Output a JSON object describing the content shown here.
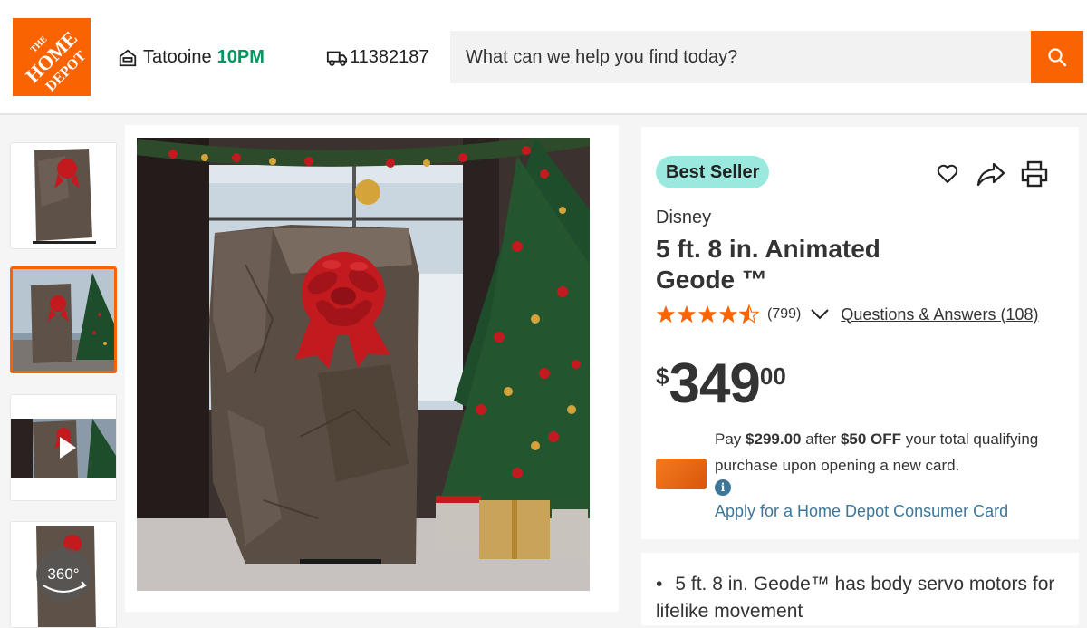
{
  "header": {
    "logo_text": "THE HOME DEPOT",
    "store_icon": "store-icon",
    "store_name": "Tatooine",
    "store_time": "10PM",
    "delivery_icon": "truck-icon",
    "delivery_zip": "11382187",
    "search_placeholder": "What can we help you find today?",
    "search_icon": "search-icon"
  },
  "gallery": {
    "thumbnails": [
      {
        "kind": "image",
        "active": false
      },
      {
        "kind": "image",
        "active": true
      },
      {
        "kind": "video",
        "active": false
      },
      {
        "kind": "360",
        "active": false,
        "label": "360°"
      }
    ]
  },
  "product": {
    "badge": "Best Seller",
    "actions": [
      "favorite-icon",
      "share-icon",
      "print-icon"
    ],
    "brand": "Disney",
    "title": "5 ft. 8 in. Animated Geode ™",
    "rating": 4.5,
    "review_count": "(799)",
    "qa_label": "Questions & Answers (108)",
    "price": {
      "currency": "$",
      "dollars": "349",
      "cents": "00"
    },
    "offer": {
      "pre": "Pay ",
      "sale_price": "$299.00",
      "mid": " after ",
      "discount": "$50 OFF",
      "post": " your total qualifying purchase upon opening a new card."
    },
    "apply_link": "Apply for a Home Depot Consumer Card",
    "bullet_1": "5 ft. 8 in. Geode™ has body servo motors for lifelike movement"
  },
  "colors": {
    "brand_orange": "#f96302",
    "store_time_green": "#00965e",
    "badge_bg": "#9be8de",
    "link_blue": "#3e7697",
    "star": "#f96302"
  }
}
